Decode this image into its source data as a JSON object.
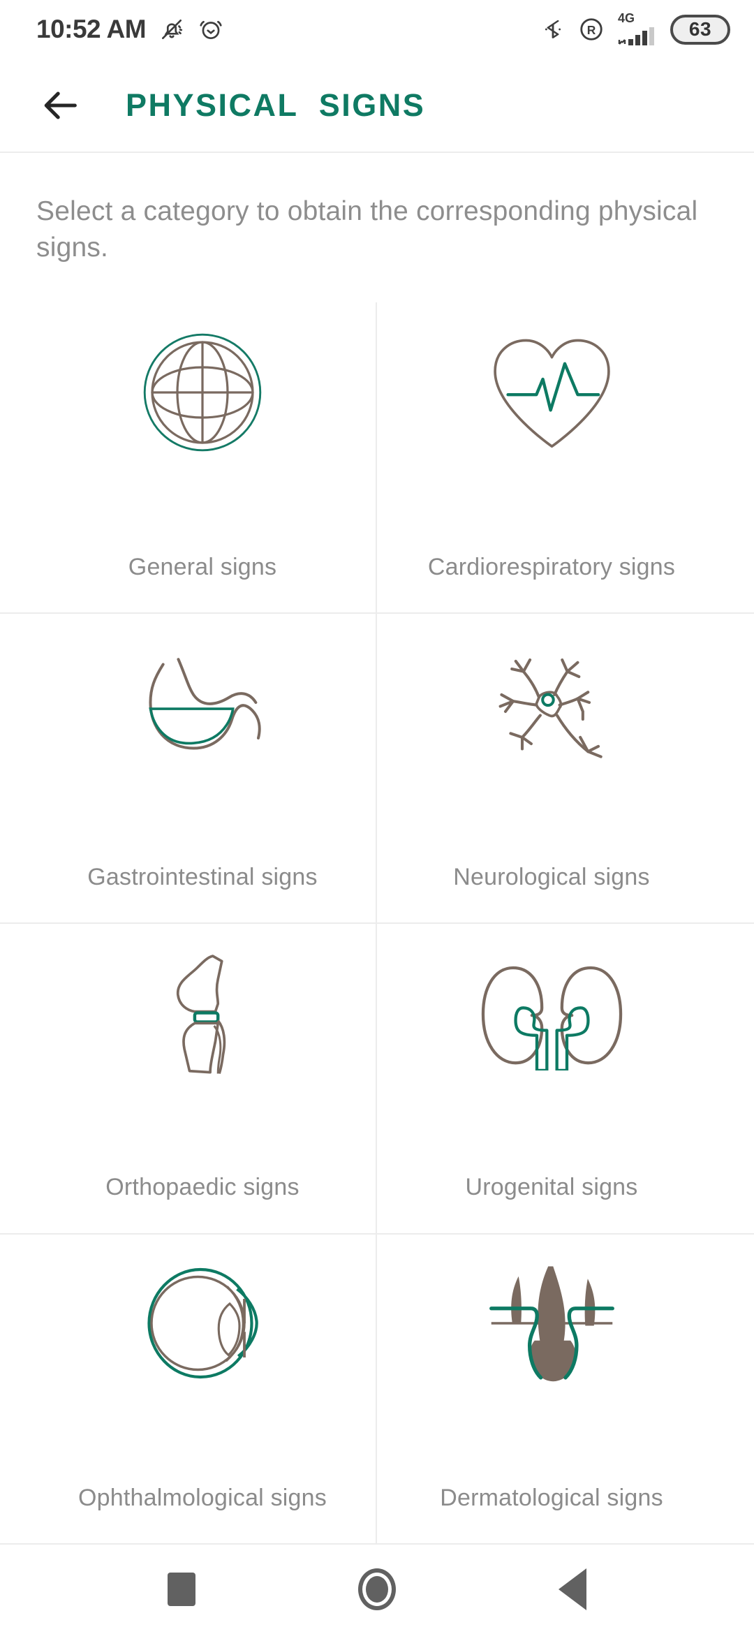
{
  "statusbar": {
    "time": "10:52 AM",
    "left_icons": [
      "bell-muted-icon",
      "alarm-clock-icon"
    ],
    "network_label": "4G",
    "battery_level": "63",
    "right_icons": [
      "bluetooth-icon",
      "roaming-icon",
      "signal-bars-icon",
      "battery-icon"
    ]
  },
  "appbar": {
    "back_icon": "arrow-left-icon",
    "title": "PHYSICAL  SIGNS",
    "title_color": "#0f7a63"
  },
  "main": {
    "subtitle": "Select a category to obtain the corresponding physical signs.",
    "categories": [
      {
        "label": "General signs",
        "icon": "globe-icon"
      },
      {
        "label": "Cardiorespiratory signs",
        "icon": "heart-ecg-icon"
      },
      {
        "label": "Gastrointestinal signs",
        "icon": "stomach-icon"
      },
      {
        "label": "Neurological signs",
        "icon": "neuron-icon"
      },
      {
        "label": "Orthopaedic signs",
        "icon": "knee-joint-icon"
      },
      {
        "label": "Urogenital signs",
        "icon": "kidneys-icon"
      },
      {
        "label": "Ophthalmological signs",
        "icon": "eye-icon"
      },
      {
        "label": "Dermatological signs",
        "icon": "hair-follicle-icon"
      }
    ]
  },
  "navbar": {
    "recents_label": "recents-square-icon",
    "home_label": "home-circle-icon",
    "back_label": "back-triangle-icon"
  },
  "colors": {
    "accent_teal": "#0f7a63",
    "icon_brown": "#7a6a60",
    "text_grey": "#8b8b8b",
    "divider": "#ececec"
  }
}
